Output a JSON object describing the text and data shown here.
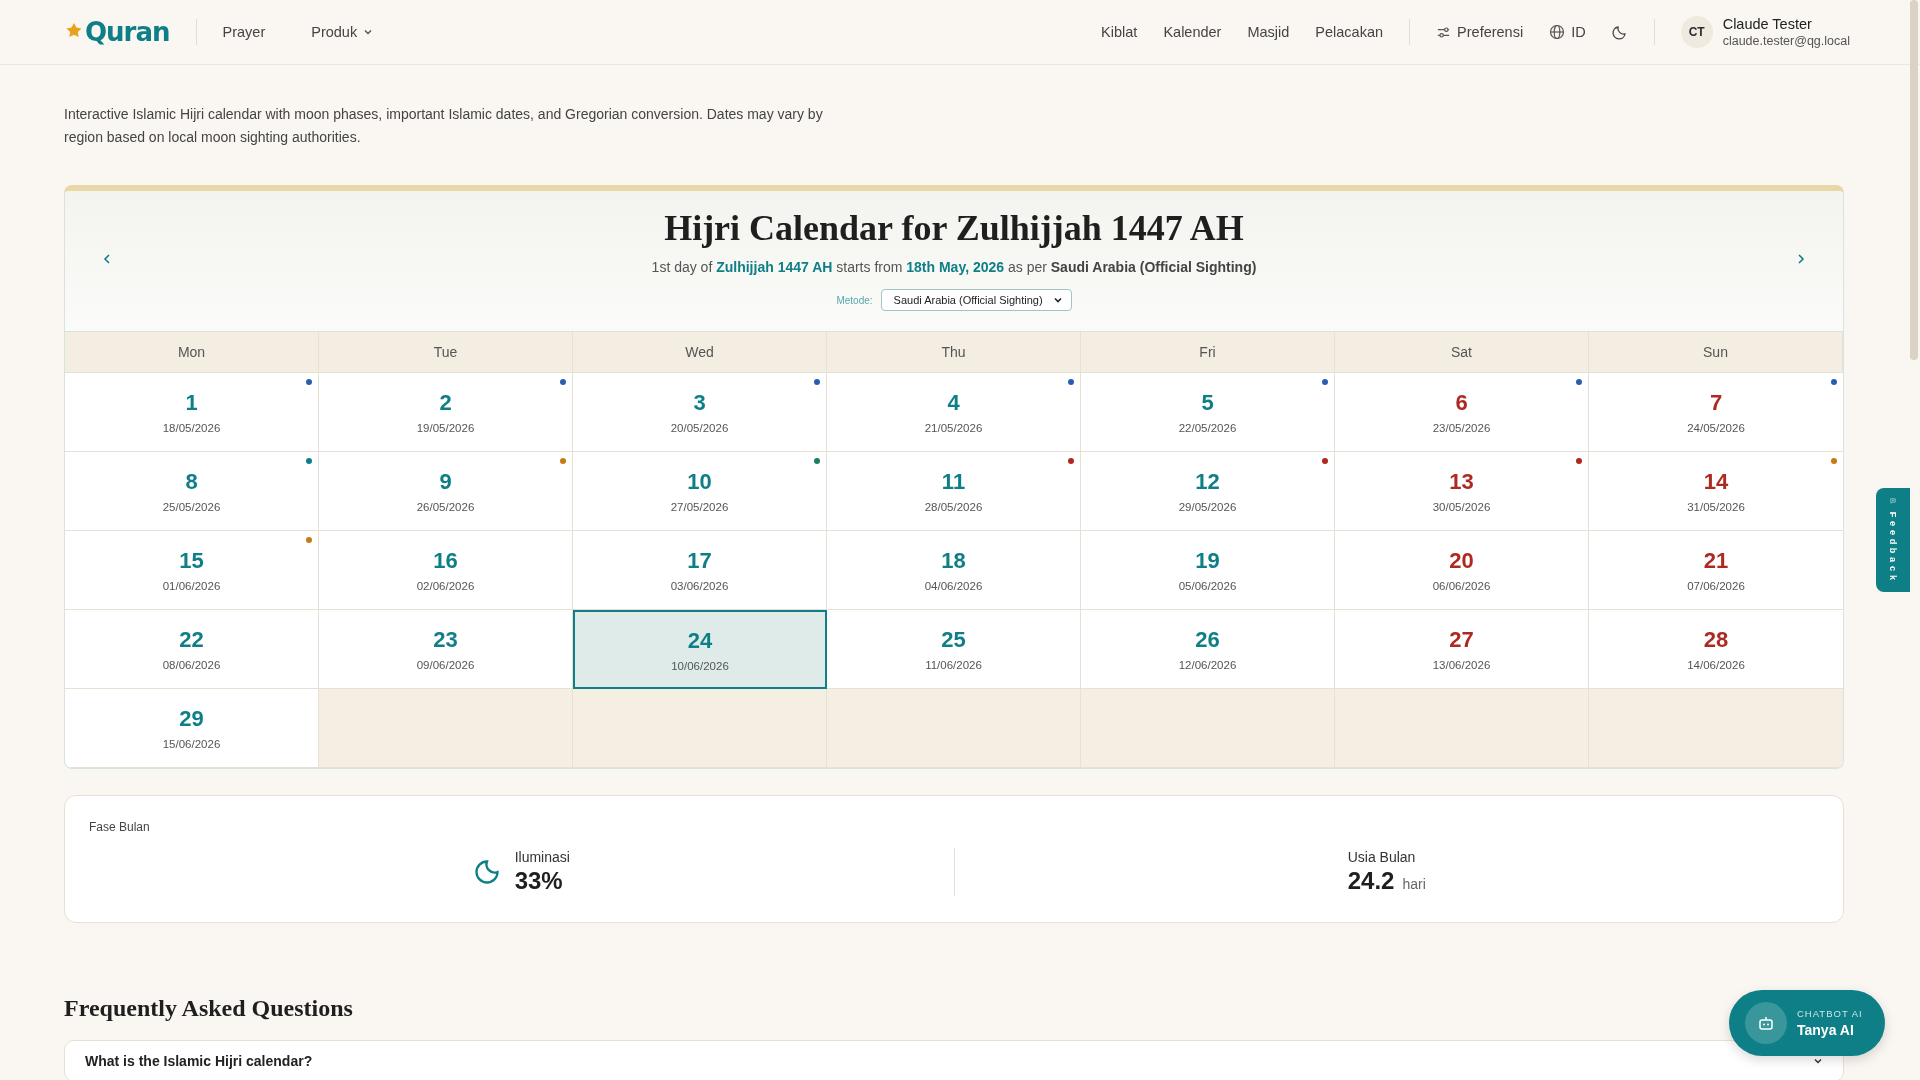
{
  "header": {
    "logo": "Quran",
    "nav_left": [
      {
        "label": "Prayer",
        "dropdown": false
      },
      {
        "label": "Produk",
        "dropdown": true
      }
    ],
    "nav_right": [
      "Kiblat",
      "Kalender",
      "Masjid",
      "Pelacakan"
    ],
    "preferences": "Preferensi",
    "language": "ID",
    "user": {
      "initials": "CT",
      "name": "Claude Tester",
      "email": "claude.tester@qg.local"
    }
  },
  "intro": "Interactive Islamic Hijri calendar with moon phases, important Islamic dates, and Gregorian conversion. Dates may vary by region based on local moon sighting authorities.",
  "calendar": {
    "title": "Hijri Calendar for Zulhijjah 1447 AH",
    "subtitle": "1st day of **Zulhijjah 1447 AH** starts from **18th May, 2026** as per **Saudi Arabia (Official Sighting)**",
    "method_label": "Metode:",
    "method_value": "Saudi Arabia (Official Sighting)",
    "weekdays": [
      "Mon",
      "Tue",
      "Wed",
      "Thu",
      "Fri",
      "Sat",
      "Sun"
    ],
    "days": [
      {
        "day": "1",
        "date": "18/05/2026",
        "weekend": false,
        "selected": false,
        "color": "#2a5db0"
      },
      {
        "day": "2",
        "date": "19/05/2026",
        "weekend": false,
        "selected": false,
        "color": "#2a5db0"
      },
      {
        "day": "3",
        "date": "20/05/2026",
        "weekend": false,
        "selected": false,
        "color": "#2a5db0"
      },
      {
        "day": "4",
        "date": "21/05/2026",
        "weekend": false,
        "selected": false,
        "color": "#2a5db0"
      },
      {
        "day": "5",
        "date": "22/05/2026",
        "weekend": false,
        "selected": false,
        "color": "#2a5db0"
      },
      {
        "day": "6",
        "date": "23/05/2026",
        "weekend": true,
        "selected": false,
        "color": "#2a5db0"
      },
      {
        "day": "7",
        "date": "24/05/2026",
        "weekend": true,
        "selected": false,
        "color": "#2a5db0"
      },
      {
        "day": "8",
        "date": "25/05/2026",
        "weekend": false,
        "selected": false,
        "color": "#0e7f86"
      },
      {
        "day": "9",
        "date": "26/05/2026",
        "weekend": false,
        "selected": false,
        "color": "#c77a12"
      },
      {
        "day": "10",
        "date": "27/05/2026",
        "weekend": false,
        "selected": false,
        "color": "#1b7f5f"
      },
      {
        "day": "11",
        "date": "28/05/2026",
        "weekend": false,
        "selected": false,
        "color": "#b3261e"
      },
      {
        "day": "12",
        "date": "29/05/2026",
        "weekend": false,
        "selected": false,
        "color": "#b3261e"
      },
      {
        "day": "13",
        "date": "30/05/2026",
        "weekend": true,
        "selected": false,
        "color": "#b3261e"
      },
      {
        "day": "14",
        "date": "31/05/2026",
        "weekend": true,
        "selected": false,
        "color": "#c77a12"
      },
      {
        "day": "15",
        "date": "01/06/2026",
        "weekend": false,
        "selected": false,
        "color": "#c77a12"
      },
      {
        "day": "16",
        "date": "02/06/2026",
        "weekend": false,
        "selected": false
      },
      {
        "day": "17",
        "date": "03/06/2026",
        "weekend": false,
        "selected": false
      },
      {
        "day": "18",
        "date": "04/06/2026",
        "weekend": false,
        "selected": false
      },
      {
        "day": "19",
        "date": "05/06/2026",
        "weekend": false,
        "selected": false
      },
      {
        "day": "20",
        "date": "06/06/2026",
        "weekend": true,
        "selected": false
      },
      {
        "day": "21",
        "date": "07/06/2026",
        "weekend": true,
        "selected": false
      },
      {
        "day": "22",
        "date": "08/06/2026",
        "weekend": false,
        "selected": false
      },
      {
        "day": "23",
        "date": "09/06/2026",
        "weekend": false,
        "selected": false
      },
      {
        "day": "24",
        "date": "10/06/2026",
        "weekend": false,
        "selected": true
      },
      {
        "day": "25",
        "date": "11/06/2026",
        "weekend": false,
        "selected": false
      },
      {
        "day": "26",
        "date": "12/06/2026",
        "weekend": false,
        "selected": false
      },
      {
        "day": "27",
        "date": "13/06/2026",
        "weekend": true,
        "selected": false
      },
      {
        "day": "28",
        "date": "14/06/2026",
        "weekend": true,
        "selected": false
      },
      {
        "day": "29",
        "date": "15/06/2026",
        "weekend": false,
        "selected": false
      }
    ]
  },
  "moon_phase": {
    "title": "Fase Bulan",
    "illumination_label": "Iluminasi",
    "illumination_value": "33%",
    "age_label": "Usia Bulan",
    "age_value": "24.2",
    "age_unit": "hari"
  },
  "faq": {
    "title": "Frequently Asked Questions",
    "items": [
      {
        "question": "What is the Islamic Hijri calendar?",
        "expanded": false
      }
    ]
  },
  "chatbot": {
    "tag": "CHATBOT AI",
    "label": "Tanya AI"
  },
  "feedback": "Feedback"
}
